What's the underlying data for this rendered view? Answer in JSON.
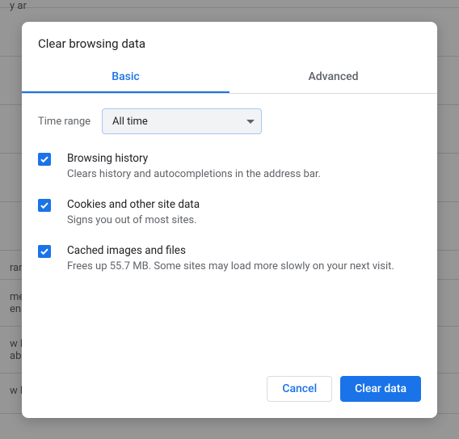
{
  "dialog": {
    "title": "Clear browsing data",
    "tabs": {
      "basic": "Basic",
      "advanced": "Advanced"
    },
    "time_range": {
      "label": "Time range",
      "value": "All time"
    },
    "options": {
      "history": {
        "title": "Browsing history",
        "desc": "Clears history and autocompletions in the address bar."
      },
      "cookies": {
        "title": "Cookies and other site data",
        "desc": "Signs you out of most sites."
      },
      "cache": {
        "title": "Cached images and files",
        "desc": "Frees up 55.7 MB. Some sites may load more slowly on your next visit."
      }
    },
    "footer": {
      "cancel": "Cancel",
      "clear": "Clear data"
    }
  },
  "bg": {
    "r0": "y ar",
    "r1": "ran",
    "r2": "me",
    "r2b": "en C",
    "r3": "w h",
    "r3b": "able",
    "r4": "w bookmarks bar"
  }
}
